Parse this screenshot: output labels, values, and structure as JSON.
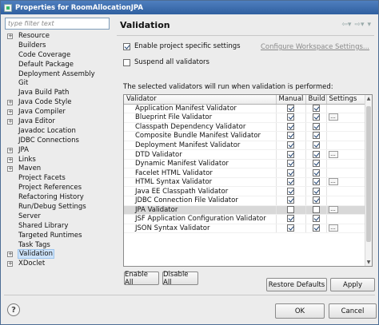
{
  "window": {
    "title": "Properties for RoomAllocationJPA"
  },
  "left": {
    "filter_placeholder": "type filter text",
    "tree": [
      {
        "label": "Resource",
        "expandable": true
      },
      {
        "label": "Builders",
        "expandable": false
      },
      {
        "label": "Code Coverage",
        "expandable": false
      },
      {
        "label": "Default Package",
        "expandable": false
      },
      {
        "label": "Deployment Assembly",
        "expandable": false
      },
      {
        "label": "Git",
        "expandable": false
      },
      {
        "label": "Java Build Path",
        "expandable": false
      },
      {
        "label": "Java Code Style",
        "expandable": true
      },
      {
        "label": "Java Compiler",
        "expandable": true
      },
      {
        "label": "Java Editor",
        "expandable": true
      },
      {
        "label": "Javadoc Location",
        "expandable": false
      },
      {
        "label": "JDBC Connections",
        "expandable": false
      },
      {
        "label": "JPA",
        "expandable": true
      },
      {
        "label": "Links",
        "expandable": true
      },
      {
        "label": "Maven",
        "expandable": true
      },
      {
        "label": "Project Facets",
        "expandable": false
      },
      {
        "label": "Project References",
        "expandable": false
      },
      {
        "label": "Refactoring History",
        "expandable": false
      },
      {
        "label": "Run/Debug Settings",
        "expandable": false
      },
      {
        "label": "Server",
        "expandable": false
      },
      {
        "label": "Shared Library",
        "expandable": false
      },
      {
        "label": "Targeted Runtimes",
        "expandable": false
      },
      {
        "label": "Task Tags",
        "expandable": false
      },
      {
        "label": "Validation",
        "expandable": true,
        "selected": true
      },
      {
        "label": "XDoclet",
        "expandable": true
      }
    ]
  },
  "right": {
    "title": "Validation",
    "enable_specific": "Enable project specific settings",
    "configure_link": "Configure Workspace Settings...",
    "suspend_all": "Suspend all validators",
    "info": "The selected validators will run when validation is performed:",
    "columns": [
      "Validator",
      "Manual",
      "Build",
      "Settings"
    ],
    "validators": [
      {
        "name": "Application Manifest Validator",
        "manual": true,
        "build": true,
        "settings": false
      },
      {
        "name": "Blueprint File Validator",
        "manual": true,
        "build": true,
        "settings": true
      },
      {
        "name": "Classpath Dependency Validator",
        "manual": true,
        "build": true,
        "settings": false
      },
      {
        "name": "Composite Bundle Manifest Validator",
        "manual": true,
        "build": true,
        "settings": false
      },
      {
        "name": "Deployment Manifest Validator",
        "manual": true,
        "build": true,
        "settings": false
      },
      {
        "name": "DTD Validator",
        "manual": true,
        "build": true,
        "settings": true
      },
      {
        "name": "Dynamic Manifest Validator",
        "manual": true,
        "build": true,
        "settings": false
      },
      {
        "name": "Facelet HTML Validator",
        "manual": true,
        "build": true,
        "settings": false
      },
      {
        "name": "HTML Syntax Validator",
        "manual": true,
        "build": true,
        "settings": true
      },
      {
        "name": "Java EE Classpath Validator",
        "manual": true,
        "build": true,
        "settings": false
      },
      {
        "name": "JDBC Connection File Validator",
        "manual": true,
        "build": true,
        "settings": false
      },
      {
        "name": "JPA Validator",
        "manual": false,
        "build": false,
        "settings": true,
        "selected": true
      },
      {
        "name": "JSF Application Configuration Validator",
        "manual": true,
        "build": true,
        "settings": false
      },
      {
        "name": "JSON Syntax Validator",
        "manual": true,
        "build": true,
        "settings": true
      }
    ],
    "enable_all": "Enable All",
    "disable_all": "Disable All",
    "restore_defaults": "Restore Defaults",
    "apply": "Apply"
  },
  "footer": {
    "help": "?",
    "ok": "OK",
    "cancel": "Cancel"
  }
}
